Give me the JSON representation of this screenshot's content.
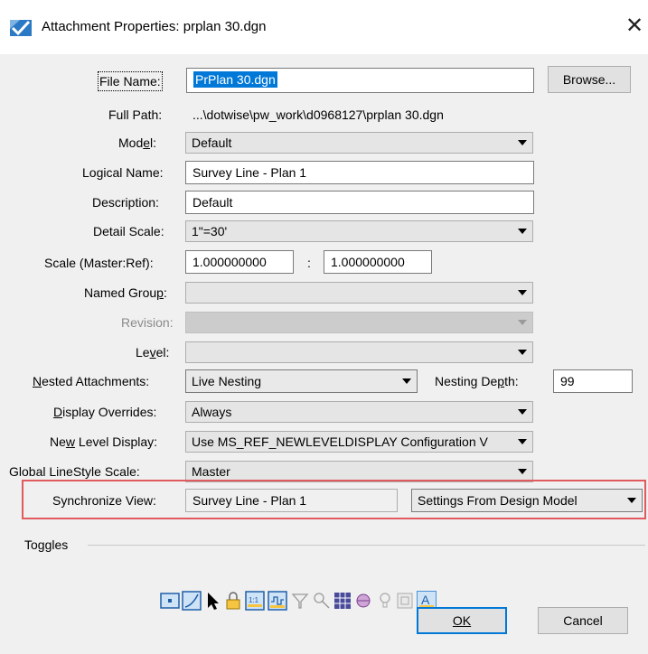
{
  "window": {
    "title": "Attachment Properties: prplan 30.dgn",
    "close_glyph": "✕"
  },
  "fields": {
    "file_name": {
      "label": "File Name:",
      "value": "PrPlan 30.dgn"
    },
    "browse_label": "Browse...",
    "full_path": {
      "label": "Full Path:",
      "value": "...\\dotwise\\pw_work\\d0968127\\prplan 30.dgn"
    },
    "model": {
      "label": "Model:",
      "value": "Default"
    },
    "logical_name": {
      "label": "Logical Name:",
      "value": "Survey Line - Plan 1"
    },
    "description": {
      "label": "Description:",
      "value": "Default"
    },
    "detail_scale": {
      "label": "Detail Scale:",
      "value": "1\"=30'"
    },
    "scale": {
      "label": "Scale (Master:Ref):",
      "master": "1.000000000",
      "separator": ":",
      "ref": "1.000000000"
    },
    "named_group": {
      "label": "Named Group:",
      "value": ""
    },
    "revision": {
      "label": "Revision:",
      "value": ""
    },
    "level": {
      "label": "Level:",
      "value": ""
    },
    "nested_attachments": {
      "label": "Nested Attachments:",
      "value": "Live Nesting"
    },
    "nesting_depth": {
      "label": "Nesting Depth:",
      "value": "99"
    },
    "display_overrides": {
      "label": "Display Overrides:",
      "value": "Always"
    },
    "new_level_display": {
      "label": "New Level Display:",
      "value": "Use MS_REF_NEWLEVELDISPLAY Configuration V"
    },
    "global_linestyle_scale": {
      "label": "Global LineStyle Scale:",
      "value": "Master"
    },
    "synchronize_view": {
      "label": "Synchronize View:",
      "value": "Survey Line - Plan 1",
      "mode": "Settings From Design Model"
    }
  },
  "toggles": {
    "label": "Toggles",
    "icons": [
      "display-toggle-icon",
      "snap-toggle-icon",
      "locate-toggle-icon",
      "lock-toggle-icon",
      "true-scale-toggle-icon",
      "scale-line-styles-toggle-icon",
      "ignore-attachment-toggle-icon",
      "use-lights-toggle-icon",
      "treat-as-element-toggle-icon",
      "display-raster-toggle-icon",
      "light-bulb-toggle-icon",
      "level-override-toggle-icon",
      "annotation-scale-toggle-icon"
    ]
  },
  "buttons": {
    "ok": "OK",
    "cancel": "Cancel"
  },
  "colors": {
    "selection": "#0078d7",
    "highlight_box": "#e05a5f",
    "dialog_bg": "#f0f0f0"
  }
}
